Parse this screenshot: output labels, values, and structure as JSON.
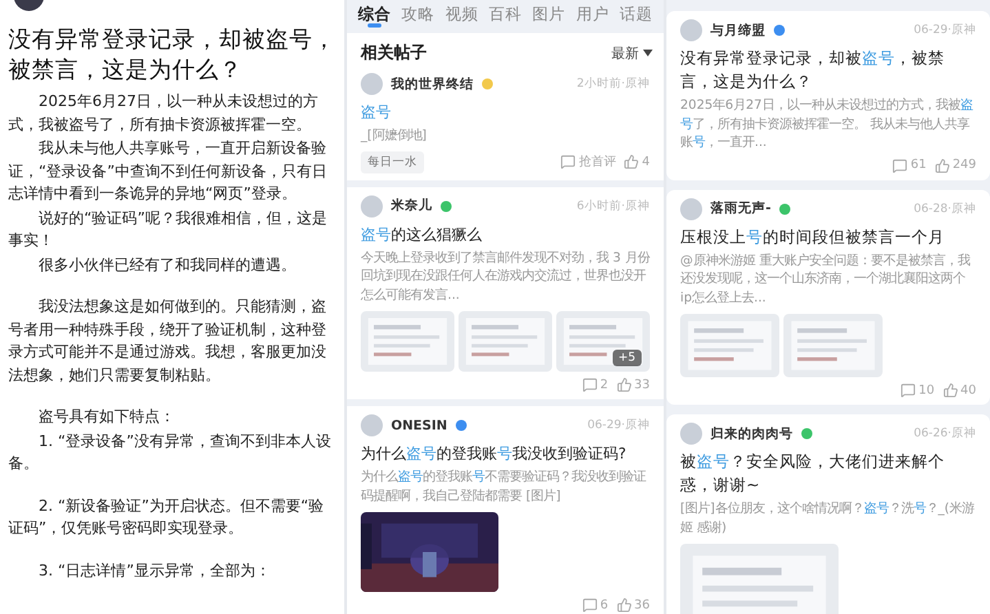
{
  "article": {
    "title": "没有异常登录记录，却被盗号，被禁言，这是为什么？",
    "sections": [
      [
        "2025年6月27日，以一种从未设想过的方式，我被盗号了，所有抽卡资源被挥霍一空。",
        "我从未与他人共享账号，一直开启新设备验证，“登录设备”中查询不到任何新设备，只有日志详情中看到一条诡异的异地“网页”登录。",
        "说好的“验证码”呢？我很难相信，但，这是事实！",
        "很多小伙伴已经有了和我同样的遭遇。"
      ],
      [
        "我没法想象这是如何做到的。只能猜测，盗号者用一种特殊手段，绕开了验证机制，这种登录方式可能并不是通过游戏。我想，客服更加没法想象，她们只需要复制粘贴。"
      ],
      [
        "盗号具有如下特点：",
        "1. “登录设备”没有异常，查询不到非本人设备。"
      ],
      [
        "2. “新设备验证”为开启状态。但不需要“验证码”，仅凭账号密码即实现登录。"
      ],
      [
        "3. “日志详情”显示异常，全部为："
      ]
    ]
  },
  "search": {
    "tabs": [
      {
        "label": "综合",
        "selected": true
      },
      {
        "label": "攻略",
        "selected": false
      },
      {
        "label": "视频",
        "selected": false
      },
      {
        "label": "百科",
        "selected": false
      },
      {
        "label": "图片",
        "selected": false
      },
      {
        "label": "用户",
        "selected": false
      },
      {
        "label": "话题",
        "selected": false
      }
    ],
    "section_title": "相关帖子",
    "sort": "最新",
    "posts": [
      {
        "author": "我的世界终结",
        "color": "#f2c94c",
        "meta": "2小时前·原神",
        "title": [
          {
            "text": "盗号",
            "highlight": true
          }
        ],
        "body": [
          {
            "text": "_[阿嬷倒地]",
            "highlight": false
          }
        ],
        "tag": "每日一水",
        "comments": "抢首评",
        "likes": "4"
      },
      {
        "author": "米奈儿",
        "color": "#3cc46a",
        "meta": "6小时前·原神",
        "title": [
          {
            "text": "盗号",
            "highlight": true
          },
          {
            "text": "的这么猖獗么",
            "highlight": false
          }
        ],
        "body": [
          {
            "text": "今天晚上登录收到了禁言邮件发现不对劲，我 3 月份回坑到现在没跟任何人在游戏内交流过，世界也没开怎么可能有发言...",
            "highlight": false
          }
        ],
        "media": [
          {
            "kind": "picture"
          },
          {
            "kind": "picture"
          },
          {
            "kind": "picture"
          }
        ],
        "more": "+5",
        "comments": "2",
        "likes": "33"
      },
      {
        "author": "ONESIN",
        "color": "#3d8ef0",
        "meta": "06-29·原神",
        "title": [
          {
            "text": "为什么",
            "highlight": false
          },
          {
            "text": "盗号",
            "highlight": true
          },
          {
            "text": "的登我账",
            "highlight": false
          },
          {
            "text": "号",
            "highlight": true
          },
          {
            "text": "我没收到验证码?",
            "highlight": false
          }
        ],
        "body": [
          {
            "text": "为什么",
            "highlight": false
          },
          {
            "text": "盗号",
            "highlight": true
          },
          {
            "text": "的登我账",
            "highlight": false
          },
          {
            "text": "号",
            "highlight": true
          },
          {
            "text": "不需要验证码？我没收到验证码提醒啊，我自己登陆都需要 [图片]",
            "highlight": false
          }
        ],
        "media": [
          {
            "kind": "picture"
          }
        ],
        "comments": "6",
        "likes": "36"
      }
    ]
  },
  "feed": {
    "posts": [
      {
        "author": "与月缔盟",
        "color": "#3d8ef0",
        "meta": "06-29·原神",
        "title": [
          {
            "text": "没有异常登录记录，却被",
            "highlight": false
          },
          {
            "text": "盗号",
            "highlight": true
          },
          {
            "text": "，被禁言，这是为什么？",
            "highlight": false
          }
        ],
        "body": [
          {
            "text": "2025年6月27日，以一种从未设想过的方式，我被",
            "highlight": false
          },
          {
            "text": "盗号",
            "highlight": true
          },
          {
            "text": "了，所有抽卡资源被挥霍一空。 我从未与他人共享账",
            "highlight": false
          },
          {
            "text": "号",
            "highlight": true
          },
          {
            "text": "，一直开...",
            "highlight": false
          }
        ],
        "comments": "61",
        "likes": "249"
      },
      {
        "author": "落雨无声-",
        "color": "#3cc46a",
        "meta": "06-28·原神",
        "title": [
          {
            "text": "压根没上",
            "highlight": false
          },
          {
            "text": "号",
            "highlight": true
          },
          {
            "text": "的时间段但被禁言一个月",
            "highlight": false
          }
        ],
        "body": [
          {
            "text": "@原神米游姬  重大账户安全问题：要不是被禁言，我还没发现呢，这一个山东济南，一个湖北襄阳这两个ip怎么登上去...",
            "highlight": false
          }
        ],
        "media": [
          {
            "kind": "picture"
          },
          {
            "kind": "picture"
          }
        ],
        "comments": "10",
        "likes": "40"
      },
      {
        "author": "归来的肉肉号",
        "color": "#3cc46a",
        "meta": "06-26·原神",
        "title": [
          {
            "text": "被",
            "highlight": false
          },
          {
            "text": "盗号",
            "highlight": true
          },
          {
            "text": "？安全风险，大佬们进来解个惑，谢谢~",
            "highlight": false
          }
        ],
        "body": [
          {
            "text": "[图片]各位朋友，这个啥情况啊？",
            "highlight": false
          },
          {
            "text": "盗号",
            "highlight": true
          },
          {
            "text": "？洗",
            "highlight": false
          },
          {
            "text": "号",
            "highlight": true
          },
          {
            "text": "？_(米游姬 感谢)",
            "highlight": false
          }
        ],
        "media": [
          {
            "kind": "picture"
          }
        ]
      }
    ]
  }
}
